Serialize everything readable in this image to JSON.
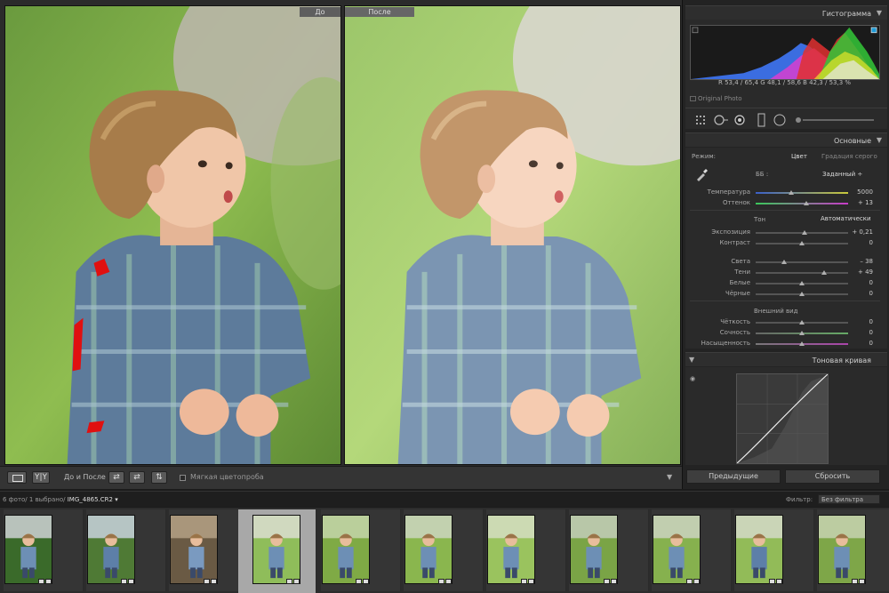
{
  "compare": {
    "before_label": "До",
    "after_label": "После"
  },
  "toolbar": {
    "view_mode": "Y|Y",
    "compare_label": "До и После :",
    "softproof_label": "Мягкая цветопроба",
    "arrow": "▼"
  },
  "panel": {
    "histogram": {
      "title": "Гистограмма",
      "values": "R  53,4 / 65,4   G  48,1 / 58,6   B  42,3 / 53,3  %",
      "original_photo": "Original Photo"
    },
    "basic": {
      "title": "Основные",
      "mode_label": "Режим:",
      "mode_color": "Цвет",
      "mode_gray": "Градация серого",
      "wb_label": "ББ :",
      "wb_value": "Заданный ÷",
      "tone_label": "Тон",
      "auto_label": "Автоматически",
      "presence_label": "Внешний вид",
      "rows": [
        {
          "label": "Температура",
          "value": "5000",
          "pos": 0.38
        },
        {
          "label": "Оттенок",
          "value": "+ 13",
          "pos": 0.55
        },
        {
          "label": "Экспозиция",
          "value": "+ 0,21",
          "pos": 0.53
        },
        {
          "label": "Контраст",
          "value": "0",
          "pos": 0.5
        },
        {
          "label": "Света",
          "value": "– 38",
          "pos": 0.31
        },
        {
          "label": "Тени",
          "value": "+ 49",
          "pos": 0.74
        },
        {
          "label": "Белые",
          "value": "0",
          "pos": 0.5
        },
        {
          "label": "Чёрные",
          "value": "0",
          "pos": 0.5
        },
        {
          "label": "Чёткость",
          "value": "0",
          "pos": 0.5
        },
        {
          "label": "Сочность",
          "value": "0",
          "pos": 0.5
        },
        {
          "label": "Насыщенность",
          "value": "0",
          "pos": 0.5
        }
      ]
    },
    "tone_curve": {
      "title": "Тоновая кривая"
    },
    "buttons": {
      "previous": "Предыдущие",
      "reset": "Сбросить"
    },
    "triangle": "▼"
  },
  "filmstrip_bar": {
    "info": "6 фото/  1 выбрано/ ",
    "file": "IMG_4865.CR2 ▾",
    "filter_label": "Фильтр:",
    "filter_value": "Без фильтра"
  },
  "colors": {
    "accent_panel": "#232323",
    "histogram_blue": "#3b6de0",
    "histogram_red": "#e03030",
    "histogram_green": "#34c838",
    "histogram_yellow": "#e6e628",
    "selected_cell": "#a8a8a8"
  },
  "icons": [
    "eyedropper-icon",
    "crop-grid-icon",
    "spot-removal-icon",
    "red-eye-icon",
    "graduated-filter-icon",
    "radial-filter-icon",
    "adjustment-brush-icon"
  ]
}
